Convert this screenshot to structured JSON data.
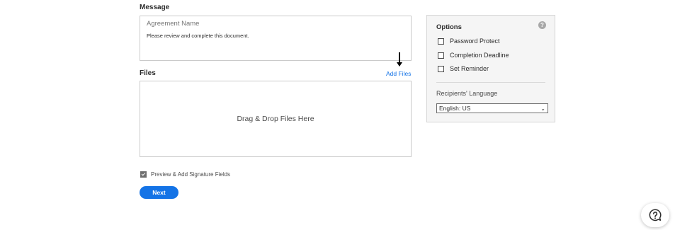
{
  "message_section": {
    "label": "Message",
    "agreement_name_placeholder": "Agreement Name",
    "message_text": "Please review and complete this document."
  },
  "files_section": {
    "label": "Files",
    "add_files_link": "Add Files",
    "dropzone_text": "Drag & Drop Files Here"
  },
  "preview_option": {
    "label": "Preview & Add Signature Fields",
    "checked": true
  },
  "next_button": {
    "label": "Next"
  },
  "options_panel": {
    "title": "Options",
    "help_glyph": "?",
    "items": [
      {
        "label": "Password Protect",
        "checked": false
      },
      {
        "label": "Completion Deadline",
        "checked": false
      },
      {
        "label": "Set Reminder",
        "checked": false
      }
    ],
    "language_label": "Recipients' Language",
    "language_selected": "English: US"
  },
  "icons": {
    "help_fab": "question-chat-icon",
    "annotation_arrow": "down-arrow-icon"
  },
  "colors": {
    "accent": "#1473e6",
    "panel_bg": "#f5f5f5",
    "border": "#cacaca"
  }
}
